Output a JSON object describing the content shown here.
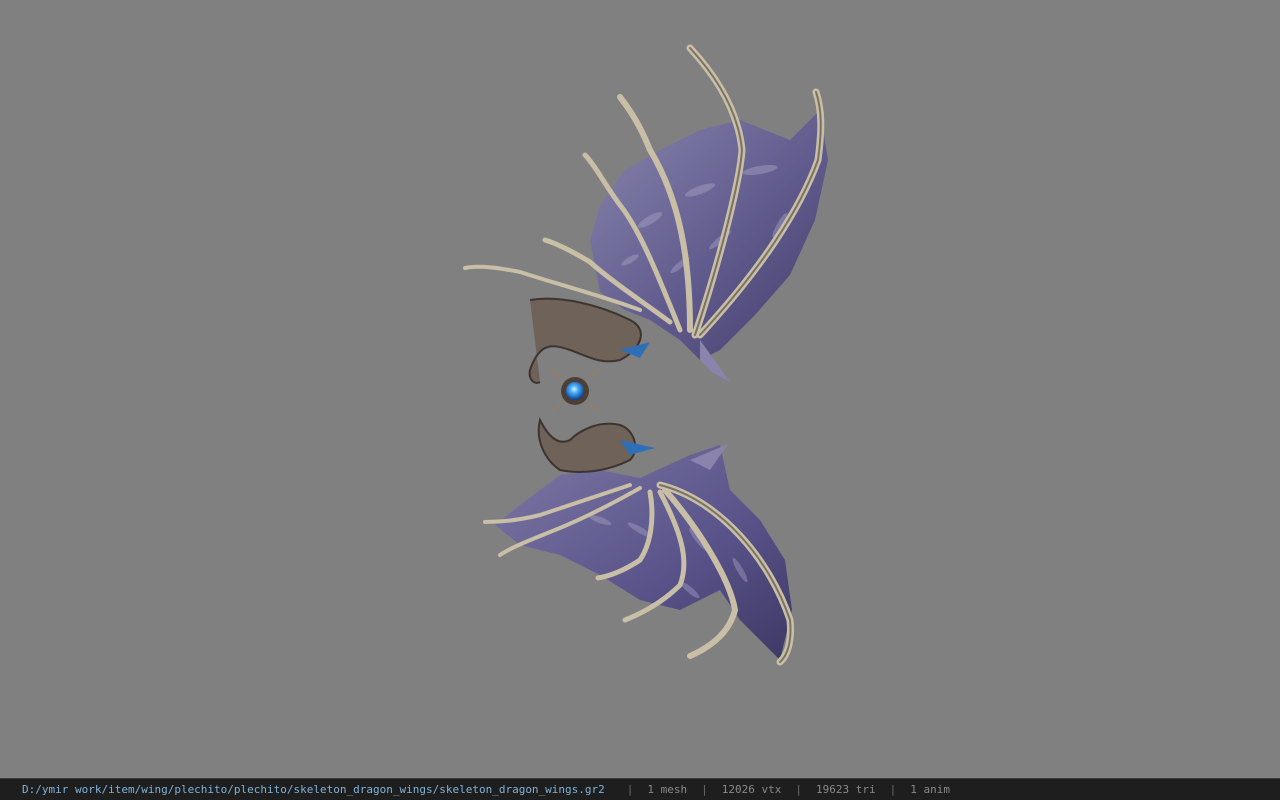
{
  "viewer": {
    "background_color": "#808080",
    "model_name": "skeleton_dragon_wings"
  },
  "status_bar": {
    "file_path": "D:/ymir work/item/wing/plechito/plechito/skeleton_dragon_wings/skeleton_dragon_wings.gr2",
    "separator": "|",
    "mesh_count": "1 mesh",
    "vertex_count": "12026 vtx",
    "triangle_count": "19623 tri",
    "anim_count": "1 anim",
    "path_color": "#7fb2d9",
    "background_color": "#1e1e1e"
  }
}
